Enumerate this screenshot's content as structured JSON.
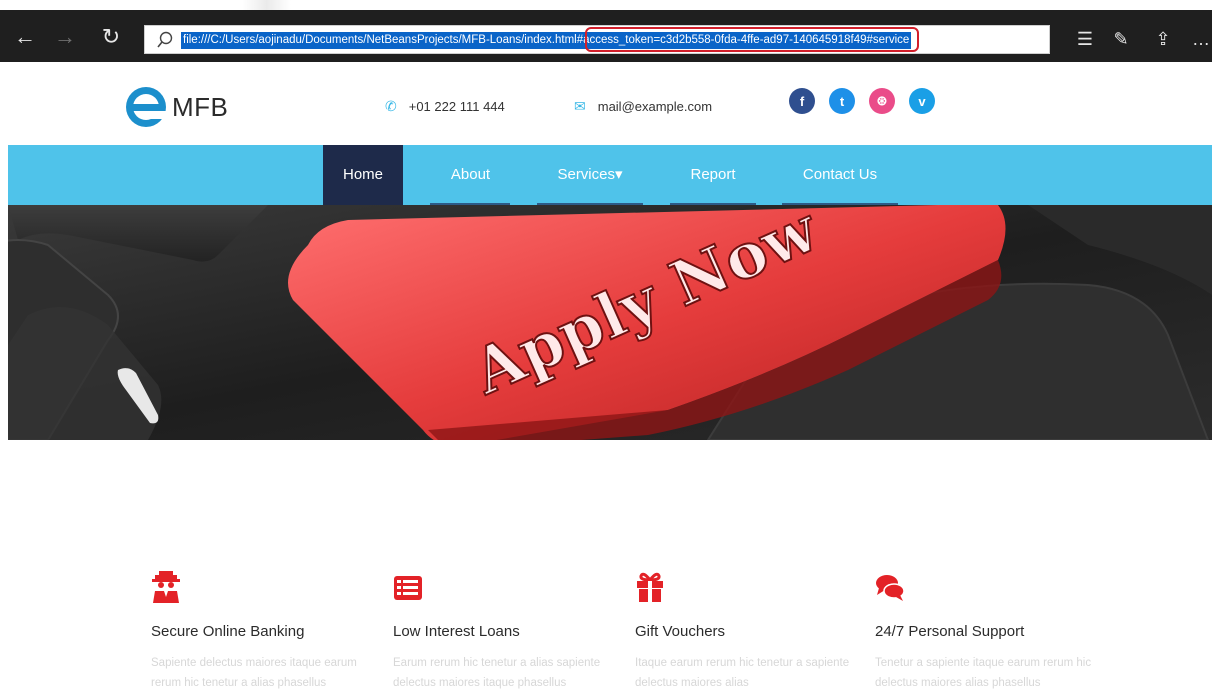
{
  "browser": {
    "url": "file:///C:/Users/aojinadu/Documents/NetBeansProjects/MFB-Loans/index.html#access_token=c3d2b558-0fda-4ffe-ad97-140645918f49#service",
    "icons": [
      "back-icon",
      "forward-icon",
      "refresh-icon",
      "search-icon",
      "reading-list-icon",
      "notes-icon",
      "share-icon",
      "more-icon"
    ]
  },
  "header": {
    "logo_text": "MFB",
    "phone": "+01 222 111 444",
    "email": "mail@example.com",
    "social": [
      "facebook",
      "twitter",
      "dribbble",
      "vimeo"
    ],
    "colors": {
      "facebook": "#3b5998",
      "twitter": "#1da1f2",
      "dribbble": "#ea4c89",
      "vimeo": "#1ab7ea",
      "accent": "#4fc3ea",
      "active_nav": "#1e2a4a",
      "service_icon": "#e32227"
    }
  },
  "nav": {
    "items": [
      {
        "label": "Home"
      },
      {
        "label": "About"
      },
      {
        "label": "Services▾"
      },
      {
        "label": "Report"
      },
      {
        "label": "Contact Us"
      }
    ]
  },
  "hero": {
    "key_text": "Apply Now"
  },
  "services": [
    {
      "title": "Secure Online Banking",
      "desc": "Sapiente delectus maiores itaque earum rerum hic tenetur a alias phasellus"
    },
    {
      "title": "Low Interest Loans",
      "desc": "Earum rerum hic tenetur a alias sapiente delectus maiores itaque phasellus"
    },
    {
      "title": "Gift Vouchers",
      "desc": "Itaque earum rerum hic tenetur a sapiente delectus maiores alias"
    },
    {
      "title": "24/7 Personal Support",
      "desc": "Tenetur a sapiente itaque earum rerum hic delectus maiores alias phasellus"
    }
  ]
}
